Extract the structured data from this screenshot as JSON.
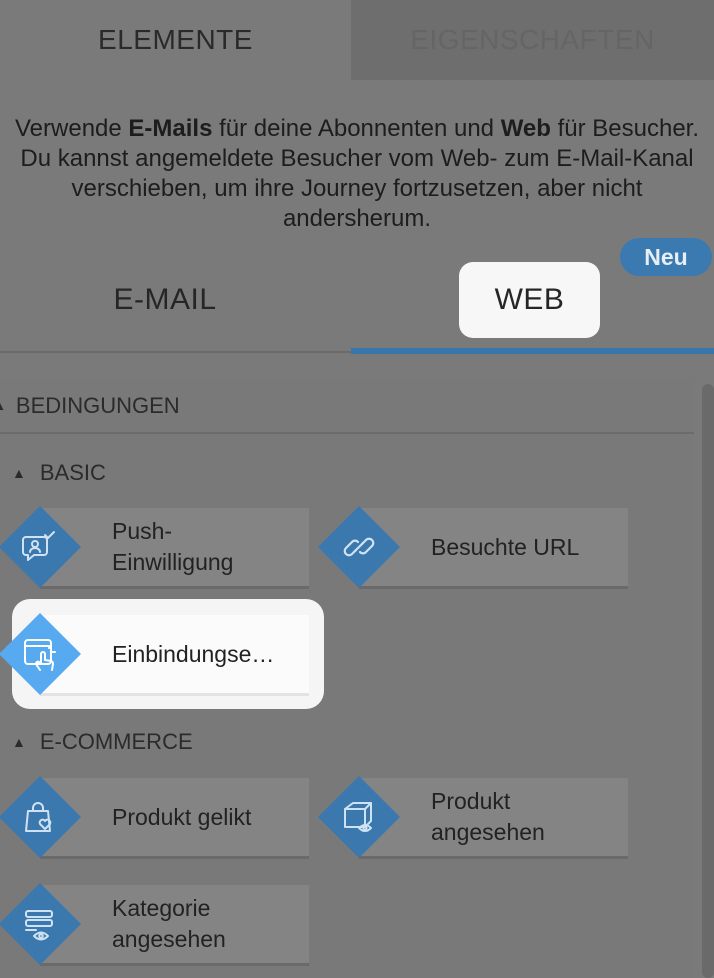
{
  "tabs": {
    "elements": "ELEMENTE",
    "properties": "EIGENSCHAFTEN"
  },
  "intro": {
    "part1": "Verwende ",
    "emails": "E-Mails",
    "part2": " für deine Abonnenten und ",
    "web": "Web",
    "part3": " für Besucher. Du kannst angemeldete Besucher vom Web- zum E-Mail-Kanal verschieben, um ihre Journey fortzusetzen, aber nicht andersherum."
  },
  "channels": {
    "email": "E-MAIL",
    "web": "WEB",
    "badge": "Neu"
  },
  "section": {
    "title": "BEDINGUNGEN"
  },
  "groups": {
    "basic": {
      "title": "BASIC",
      "items": [
        {
          "label": "Push-\nEinwilligung",
          "icon": "push-consent-icon"
        },
        {
          "label": "Besuchte URL",
          "icon": "link-icon"
        },
        {
          "label": "Einbindungse…",
          "icon": "engagement-click-icon"
        }
      ]
    },
    "ecommerce": {
      "title": "E-COMMERCE",
      "items": [
        {
          "label": "Produkt gelikt",
          "icon": "bag-heart-icon"
        },
        {
          "label": "Produkt\nangesehen",
          "icon": "box-eye-icon"
        },
        {
          "label": "Kategorie\nangesehen",
          "icon": "list-eye-icon"
        }
      ]
    }
  },
  "colors": {
    "accent": "#3676ab",
    "badge": "#3b7ab0",
    "diamond": "#3a78ad",
    "diamond_active": "#58aaf0"
  }
}
